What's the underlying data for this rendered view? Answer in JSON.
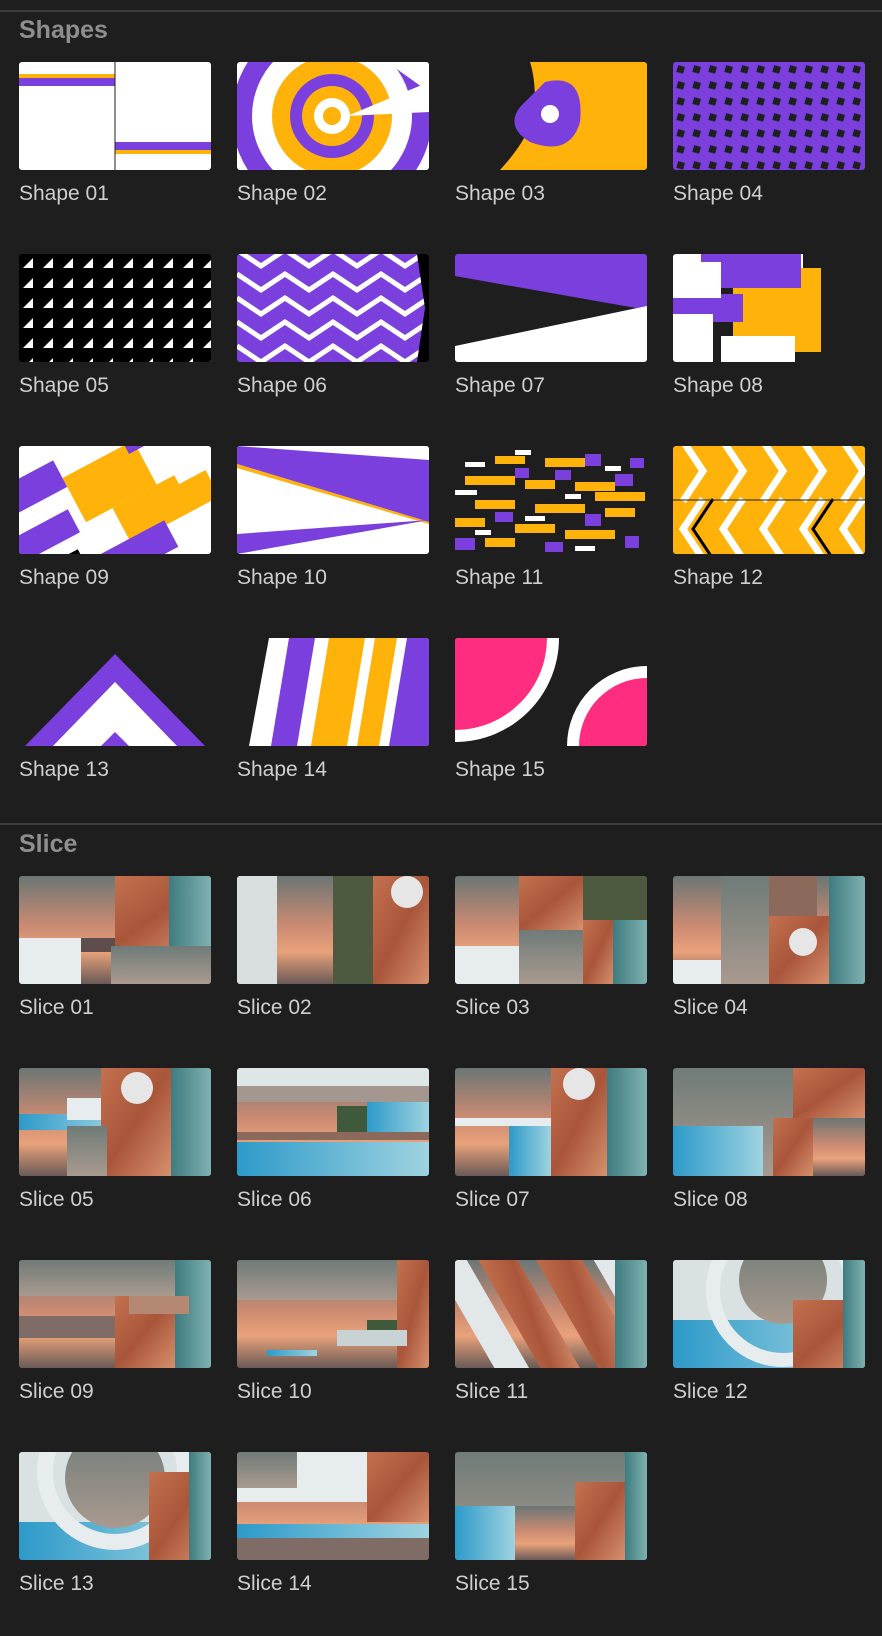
{
  "sections": {
    "shapes": {
      "title": "Shapes",
      "items": [
        "Shape 01",
        "Shape 02",
        "Shape 03",
        "Shape 04",
        "Shape 05",
        "Shape 06",
        "Shape 07",
        "Shape 08",
        "Shape 09",
        "Shape 10",
        "Shape 11",
        "Shape 12",
        "Shape 13",
        "Shape 14",
        "Shape 15"
      ]
    },
    "slice": {
      "title": "Slice",
      "items": [
        "Slice 01",
        "Slice 02",
        "Slice 03",
        "Slice 04",
        "Slice 05",
        "Slice 06",
        "Slice 07",
        "Slice 08",
        "Slice 09",
        "Slice 10",
        "Slice 11",
        "Slice 12",
        "Slice 13",
        "Slice 14",
        "Slice 15"
      ]
    }
  },
  "colors": {
    "purple": "#7a3fdc",
    "yellow": "#ffb20a",
    "pink": "#ff2d7f",
    "white": "#ffffff",
    "black": "#000000"
  }
}
